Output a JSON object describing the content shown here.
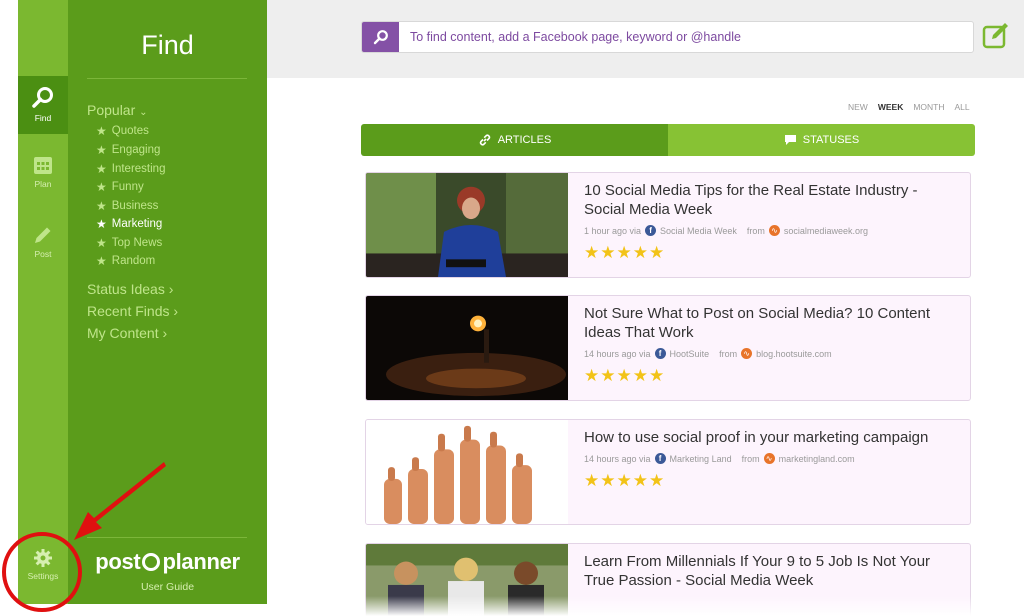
{
  "rail": {
    "items": [
      {
        "label": "Find",
        "icon": "search-icon"
      },
      {
        "label": "Plan",
        "icon": "calendar-icon"
      },
      {
        "label": "Post",
        "icon": "pencil-icon"
      }
    ],
    "settings_label": "Settings"
  },
  "panel": {
    "title": "Find",
    "popular_label": "Popular",
    "popular_items": [
      "Quotes",
      "Engaging",
      "Interesting",
      "Funny",
      "Business",
      "Marketing",
      "Top News",
      "Random"
    ],
    "active_item": "Marketing",
    "menu": [
      "Status Ideas",
      "Recent Finds",
      "My Content"
    ],
    "logo_part1": "post",
    "logo_part2": "planner",
    "user_guide": "User Guide"
  },
  "search": {
    "placeholder": "To find content, add a Facebook page, keyword or @handle"
  },
  "filters": [
    "NEW",
    "WEEK",
    "MONTH",
    "ALL"
  ],
  "active_filter": "WEEK",
  "tabs": {
    "articles": "ARTICLES",
    "statuses": "STATUSES"
  },
  "articles": [
    {
      "title": "10 Social Media Tips for the Real Estate Industry - Social Media Week",
      "time": "1 hour ago via",
      "via": "Social Media Week",
      "from_label": "from",
      "source": "socialmediaweek.org",
      "rating": 5
    },
    {
      "title": "Not Sure What to Post on Social Media? 10 Content Ideas That Work",
      "time": "14 hours ago via",
      "via": "HootSuite",
      "from_label": "from",
      "source": "blog.hootsuite.com",
      "rating": 5
    },
    {
      "title": "How to use social proof in your marketing campaign",
      "time": "14 hours ago via",
      "via": "Marketing Land",
      "from_label": "from",
      "source": "marketingland.com",
      "rating": 5
    },
    {
      "title": "Learn From Millennials If Your 9 to 5 Job Is Not Your True Passion - Social Media Week",
      "time": "",
      "via": "",
      "from_label": "",
      "source": "",
      "rating": 0
    }
  ],
  "colors": {
    "rail": "#7bb830",
    "panel": "#5b9c1b",
    "accent_purple": "#8451a6",
    "star": "#f2c318",
    "annotation": "#e01010"
  }
}
